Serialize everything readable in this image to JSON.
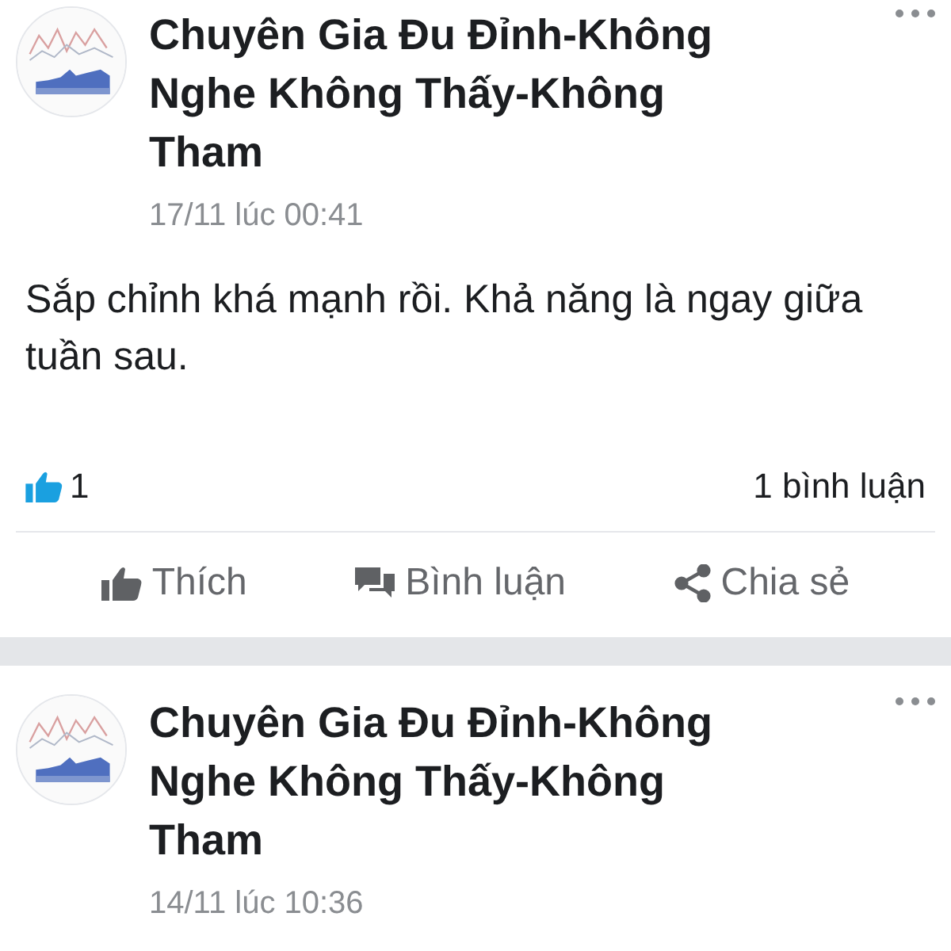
{
  "posts": [
    {
      "author": "Chuyên Gia Đu Đỉnh-Không Nghe Không Thấy-Không Tham",
      "time": "17/11 lúc 00:41",
      "text": "Sắp chỉnh khá mạnh rồi. Khả năng là ngay giữa tuần sau.",
      "likes": "1",
      "comments": "1 bình luận",
      "actions": [
        {
          "kind": "like",
          "label": "Thích"
        },
        {
          "kind": "comment",
          "label": "Bình luận"
        },
        {
          "kind": "share",
          "label": "Chia sẻ"
        }
      ]
    },
    {
      "author": "Chuyên Gia Đu Đỉnh-Không Nghe Không Thấy-Không Tham",
      "time": "14/11 lúc 10:36"
    }
  ]
}
